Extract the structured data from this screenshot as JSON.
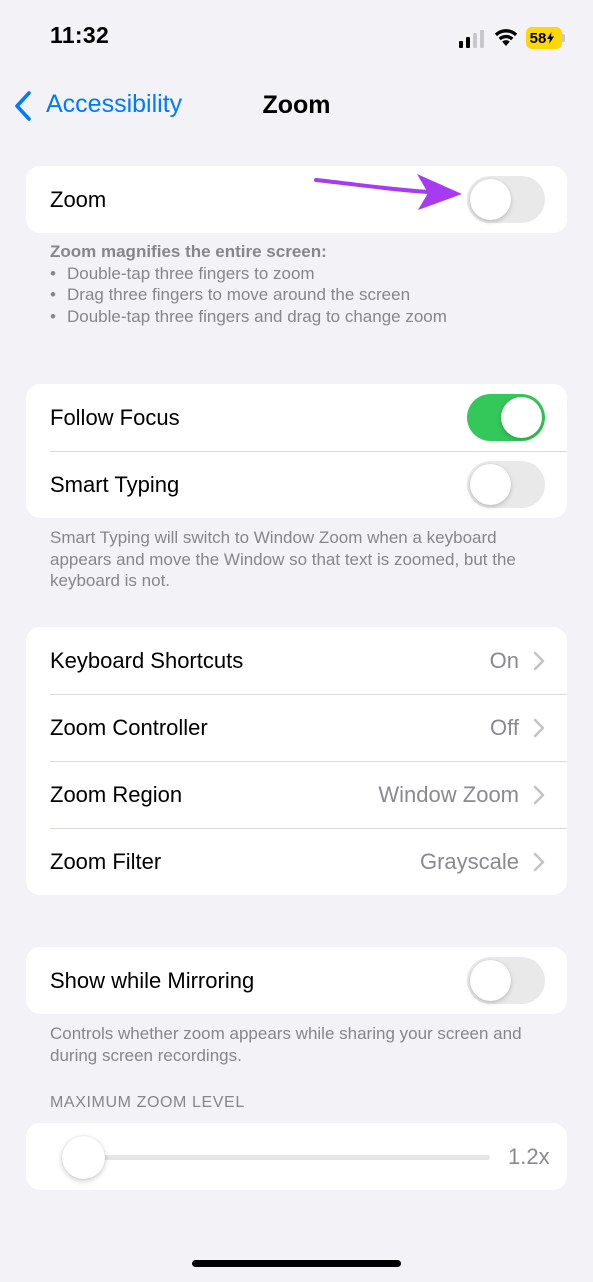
{
  "status_bar": {
    "time": "11:32",
    "battery_level": "58"
  },
  "nav": {
    "back_label": "Accessibility",
    "title": "Zoom"
  },
  "zoom_group": {
    "zoom_label": "Zoom",
    "zoom_on": false
  },
  "zoom_description": {
    "heading": "Zoom magnifies the entire screen:",
    "bullets": [
      "Double-tap three fingers to zoom",
      "Drag three fingers to move around the screen",
      "Double-tap three fingers and drag to change zoom"
    ]
  },
  "focus_group": {
    "follow_focus_label": "Follow Focus",
    "follow_focus_on": true,
    "smart_typing_label": "Smart Typing",
    "smart_typing_on": false
  },
  "smart_typing_footnote": "Smart Typing will switch to Window Zoom when a keyboard appears and move the Window so that text is zoomed, but the keyboard is not.",
  "settings_group": {
    "items": [
      {
        "label": "Keyboard Shortcuts",
        "value": "On"
      },
      {
        "label": "Zoom Controller",
        "value": "Off"
      },
      {
        "label": "Zoom Region",
        "value": "Window Zoom"
      },
      {
        "label": "Zoom Filter",
        "value": "Grayscale"
      }
    ]
  },
  "mirroring_group": {
    "label": "Show while Mirroring",
    "on": false
  },
  "mirroring_footnote": "Controls whether zoom appears while sharing your screen and during screen recordings.",
  "max_zoom": {
    "header": "MAXIMUM ZOOM LEVEL",
    "value": "1.2x",
    "slider_fraction": 0.0
  },
  "colors": {
    "accent": "#007aff",
    "toggle_on": "#34c759",
    "annotation_arrow": "#a63bf2",
    "battery": "#ffd60a"
  }
}
